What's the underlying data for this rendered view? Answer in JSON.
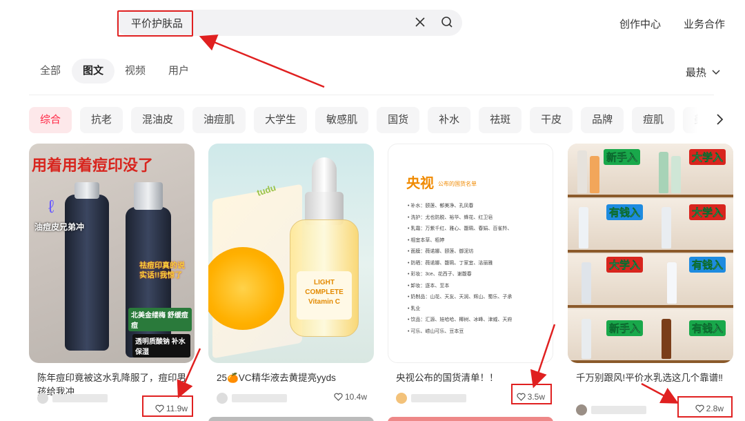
{
  "search": {
    "query": "平价护肤品"
  },
  "header": {
    "links": [
      "创作中心",
      "业务合作"
    ]
  },
  "tabs": [
    "全部",
    "图文",
    "视频",
    "用户"
  ],
  "active_tab": "图文",
  "sort": {
    "label": "最热"
  },
  "filters": [
    "综合",
    "抗老",
    "混油皮",
    "油痘肌",
    "大学生",
    "敏感肌",
    "国货",
    "补水",
    "祛斑",
    "干皮",
    "品牌",
    "痘肌",
    "美"
  ],
  "active_filter": "综合",
  "cards": [
    {
      "title": "陈年痘印竟被这水乳降服了，痘印男孩给我冲",
      "likes": "11.9w",
      "image_text": {
        "headline": "用着用着痘印没了",
        "sticker_a": "油痘皮兄弟冲",
        "sticker_b": "祛痘印真的说实话!!我惊了",
        "sticker_c": "北美金缕梅 舒缓痘痘",
        "sticker_d": "透明质酸钠 补水保湿"
      }
    },
    {
      "title": "25🍊VC精华液去黄提亮yyds",
      "likes": "10.4w",
      "image_text": {
        "brand": "tudu",
        "label": "LIGHT COMPLETE Vitamin C"
      }
    },
    {
      "title": "央视公布的国货清单！！",
      "likes": "3.5w",
      "image_text": {
        "title": "央视",
        "subtitle": "公布的国货名单",
        "list": [
          "补水：颐莲、郁美净、孔凤春",
          "洗护：尤也防脱、裕华、蜂花、红卫皂",
          "乳霜：万紫千红、雅心、馥珮、春娟、百雀羚、",
          "相宜本草、栢婷",
          "面膜：薇诺娜、颐莲、御泥坊",
          "防晒：薇诺娜、馥珮、丁家宜、洁丽雅",
          "彩妆：3ce、花西子、谢馥春",
          "卸妆：逐本、至本",
          "奶制品：山花、天友、天润、辉山、蜀乐、子承",
          "乳业",
          "饮品：汇源、娃哈哈、椰树、冰峰、津威、天府",
          "可乐、崂山可乐、豆本豆"
        ]
      }
    },
    {
      "title": "千万别跟风!平价水乳选这几个靠谱‼",
      "likes": "2.8w",
      "image_text": {
        "tags": [
          "新手入",
          "大学入",
          "有钱入",
          "大学入",
          "大学入",
          "有钱入",
          "新手入",
          "有钱入"
        ]
      }
    }
  ]
}
